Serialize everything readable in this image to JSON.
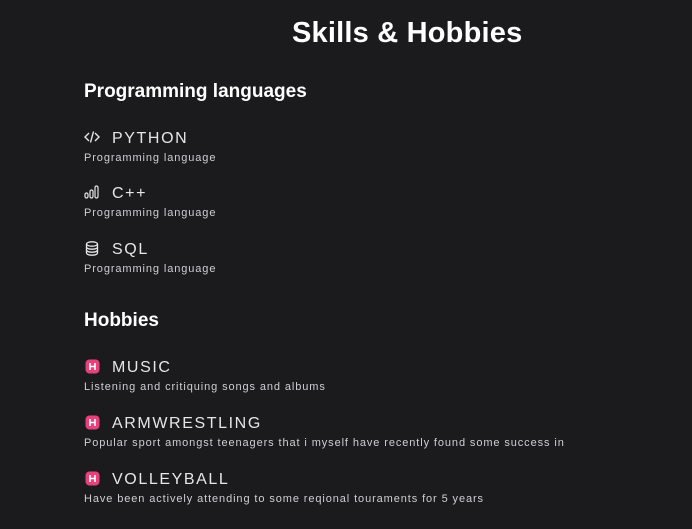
{
  "page": {
    "title": "Skills & Hobbies"
  },
  "programming": {
    "heading": "Programming languages",
    "items": [
      {
        "name": "PYTHON",
        "description": "Programming language",
        "icon": "code-icon"
      },
      {
        "name": "C++",
        "description": "Programming language",
        "icon": "bars-icon"
      },
      {
        "name": "SQL",
        "description": "Programming language",
        "icon": "database-icon"
      }
    ]
  },
  "hobbies": {
    "heading": "Hobbies",
    "items": [
      {
        "name": "MUSIC",
        "description": "Listening and critiquing songs and albums",
        "icon": "hobby-badge-icon"
      },
      {
        "name": "ARMWRESTLING",
        "description": "Popular sport amongst teenagers that i myself have recently found some success in",
        "icon": "hobby-badge-icon"
      },
      {
        "name": "VOLLEYBALL",
        "description": "Have been actively attending to some reqional touraments for 5 years",
        "icon": "hobby-badge-icon"
      }
    ]
  },
  "colors": {
    "background": "#1b1b1d",
    "text": "#e8e8ea",
    "badge": "#e8407a"
  }
}
